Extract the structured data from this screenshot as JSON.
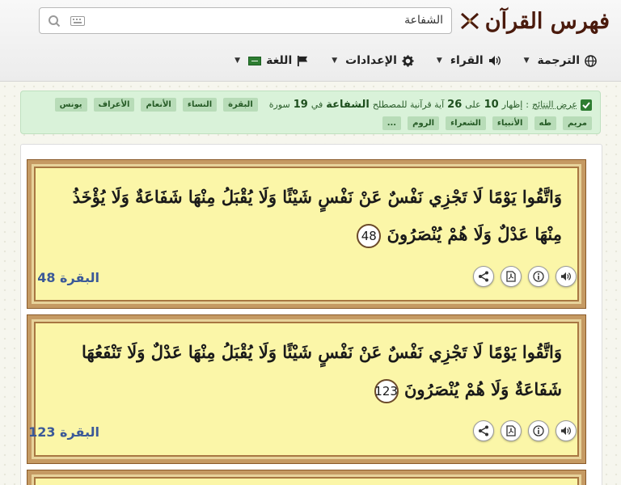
{
  "header": {
    "logo_text": "فهرس القرآن",
    "search_value": "الشفاعة"
  },
  "nav": {
    "items": [
      {
        "label": "الترجمة",
        "icon": "globe-icon"
      },
      {
        "label": "القراء",
        "icon": "speaker-icon"
      },
      {
        "label": "الإعدادات",
        "icon": "gear-icon"
      },
      {
        "label": "اللغة",
        "icon": "flag-icon"
      }
    ]
  },
  "alert": {
    "label": "عرض النتائج",
    "sep": ":",
    "p1": "إظهار",
    "shown": "10",
    "p2": "على",
    "total": "26",
    "p3": "آية قرآنية للمصطلح",
    "term": "الشفاعة",
    "p4": "في",
    "surah_count": "19",
    "p5": "سورة",
    "tags": [
      "البقرة",
      "النساء",
      "الأنعام",
      "الأعراف",
      "يونس",
      "مريم",
      "طه",
      "الأنبياء",
      "الشعراء",
      "الروم",
      "..."
    ]
  },
  "results": [
    {
      "text": "وَاتَّقُوا يَوْمًا لَا تَجْزِي نَفْسٌ عَنْ نَفْسٍ شَيْئًا وَلَا يُقْبَلُ مِنْهَا شَفَاعَةٌ وَلَا يُؤْخَذُ مِنْهَا عَدْلٌ وَلَا هُمْ يُنْصَرُونَ",
      "number": "48",
      "reference": "البقرة 48"
    },
    {
      "text": "وَاتَّقُوا يَوْمًا لَا تَجْزِي نَفْسٌ عَنْ نَفْسٍ شَيْئًا وَلَا يُقْبَلُ مِنْهَا عَدْلٌ وَلَا تَنْفَعُهَا شَفَاعَةٌ وَلَا هُمْ يُنْصَرُونَ",
      "number": "123",
      "reference": "البقرة 123"
    }
  ]
}
